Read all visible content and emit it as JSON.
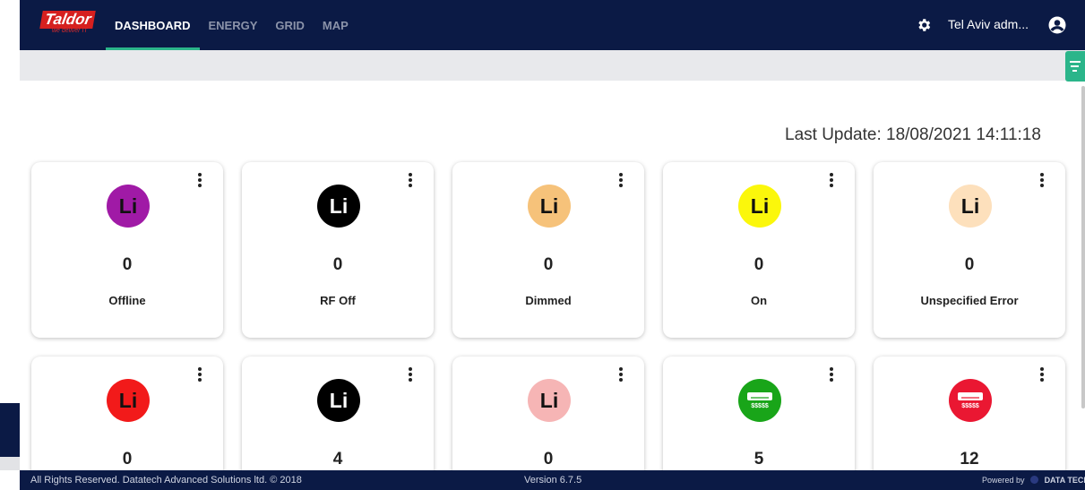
{
  "header": {
    "logo_text": "Taldor",
    "logo_tagline": "we deliver IT",
    "nav": [
      {
        "label": "DASHBOARD",
        "active": true
      },
      {
        "label": "ENERGY",
        "active": false
      },
      {
        "label": "GRID",
        "active": false
      },
      {
        "label": "MAP",
        "active": false
      }
    ],
    "user_name": "Tel Aviv adm..."
  },
  "main": {
    "last_update": "Last Update: 18/08/2021 14:11:18",
    "cards": [
      {
        "icon_text": "Li",
        "bg": "#a01aa6",
        "fg": "#111111",
        "count": "0",
        "label": "Offline"
      },
      {
        "icon_text": "Li",
        "bg": "#000000",
        "fg": "#ffffff",
        "count": "0",
        "label": "RF Off"
      },
      {
        "icon_text": "Li",
        "bg": "#f6c27a",
        "fg": "#111111",
        "count": "0",
        "label": "Dimmed"
      },
      {
        "icon_text": "Li",
        "bg": "#fbf70b",
        "fg": "#111111",
        "count": "0",
        "label": "On"
      },
      {
        "icon_text": "Li",
        "bg": "#fde0bc",
        "fg": "#111111",
        "count": "0",
        "label": "Unspecified Error"
      },
      {
        "icon_text": "Li",
        "bg": "#f21a1a",
        "fg": "#111111",
        "count": "0",
        "label": ""
      },
      {
        "icon_text": "Li",
        "bg": "#000000",
        "fg": "#ffffff",
        "count": "4",
        "label": ""
      },
      {
        "icon_text": "Li",
        "bg": "#f6b5b5",
        "fg": "#111111",
        "count": "0",
        "label": ""
      },
      {
        "icon_text": "",
        "icon": "air-conditioner-icon",
        "bg": "#19a519",
        "fg": "#ffffff",
        "count": "5",
        "label": ""
      },
      {
        "icon_text": "",
        "icon": "air-conditioner-icon",
        "bg": "#ea1732",
        "fg": "#ffffff",
        "count": "12",
        "label": ""
      }
    ]
  },
  "footer": {
    "copyright": "All Rights Reserved. Datatech Advanced Solutions ltd. © 2018",
    "version": "Version 6.7.5",
    "powered_by": "Powered by",
    "powered_brand": "DATA TECH"
  },
  "colors": {
    "navbar": "#0b1a45",
    "accent": "#2bb58a",
    "subbar": "#e8e9ec"
  }
}
